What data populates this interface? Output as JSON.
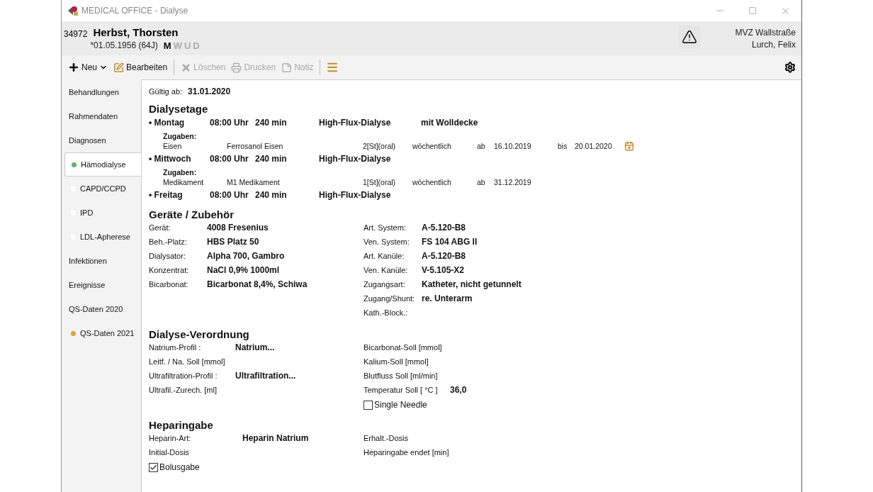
{
  "window": {
    "title": "MEDICAL OFFICE - Dialyse"
  },
  "patient": {
    "id": "34972",
    "name": "Herbst, Thorsten",
    "birth": "*01.05.1956 (64J)",
    "genders": [
      {
        "label": "M",
        "selected": true
      },
      {
        "label": "W",
        "selected": false
      },
      {
        "label": "U",
        "selected": false
      },
      {
        "label": "D",
        "selected": false
      }
    ],
    "warning": true,
    "practice": "MVZ Wallstraße",
    "doctor": "Lurch, Felix"
  },
  "toolbar": [
    {
      "kind": "add",
      "label": "Neu",
      "disabled": false
    },
    {
      "kind": "edit",
      "label": "Bearbeiten",
      "disabled": false
    },
    {
      "kind": "delete",
      "label": "Löschen",
      "disabled": true
    },
    {
      "kind": "print",
      "label": "Drucken",
      "disabled": true
    },
    {
      "kind": "note",
      "label": "Notiz",
      "disabled": true
    }
  ],
  "sidebar": {
    "items": [
      {
        "label": "Behandlungen",
        "selected": false
      },
      {
        "label": "Rahmendaten",
        "selected": false
      },
      {
        "label": "Diagnosen",
        "selected": false
      },
      {
        "label": "Hämodialyse",
        "selected": true,
        "color": "#5fb85f"
      },
      {
        "label": "CAPD/CCPD",
        "selected": false,
        "color": "#ffffff"
      },
      {
        "label": "IPD",
        "selected": false,
        "color": "#ffffff"
      },
      {
        "label": "LDL-Apherese",
        "selected": false,
        "color": "#ffffff"
      },
      {
        "label": "Infektionen",
        "selected": false
      },
      {
        "label": "Ereignisse",
        "selected": false
      },
      {
        "label": "QS-Daten 2020",
        "selected": false
      },
      {
        "label": "QS-Daten 2021",
        "selected": false,
        "color": "#e0a030"
      }
    ]
  },
  "valid_from": {
    "label": "Gültig ab:",
    "value": "31.01.2020"
  },
  "dialysis_days": {
    "title": "Dialysetage",
    "days": [
      {
        "bullet": "•",
        "day": "Montag",
        "time": "08:00 Uhr",
        "duration": "240 min",
        "type": "High-Flux-Dialyse",
        "note": "mit Wolldecke",
        "additions_title": "Zugaben:",
        "additions": [
          {
            "name": "Eisen",
            "product": "Ferrosanol Eisen",
            "dose": "2[St](oral)",
            "frequency": "wöchentlich",
            "from_prefix": "ab",
            "from": "16.10.2019",
            "to_prefix": "bis",
            "to": "20.01.2020",
            "expired": true
          }
        ]
      },
      {
        "bullet": "•",
        "day": "Mittwoch",
        "time": "08:00 Uhr",
        "duration": "240 min",
        "type": "High-Flux-Dialyse",
        "additions_title": "Zugaben:",
        "additions": [
          {
            "name": "Medikament",
            "product": "M1 Medikament",
            "dose": "1[St](oral)",
            "frequency": "wöchentlich",
            "from_prefix": "ab",
            "from": "31.12.2019",
            "expired": false
          }
        ]
      },
      {
        "bullet": "•",
        "day": "Freitag",
        "time": "08:00 Uhr",
        "duration": "240 min",
        "type": "High-Flux-Dialyse"
      }
    ]
  },
  "devices": {
    "title": "Geräte / Zubehör",
    "left": [
      {
        "label": "Gerät:",
        "value": "4008 Fresenius"
      },
      {
        "label": "Beh.-Platz:",
        "value": "HBS Platz 50"
      },
      {
        "label": "Dialysator:",
        "value": "Alpha 700, Gambro"
      },
      {
        "label": "Konzentrat:",
        "value": "NaCl 0,9% 1000ml"
      },
      {
        "label": "Bicarbonat:",
        "value": "Bicarbonat 8,4%, Schiwa"
      }
    ],
    "right": [
      {
        "label": "Art. System:",
        "value": "A-5.120-B8"
      },
      {
        "label": "Ven. System:",
        "value": "FS 104 ABG II"
      },
      {
        "label": "Art. Kanüle:",
        "value": "A-5.120-B8"
      },
      {
        "label": "Ven. Kanüle:",
        "value": "V-5.105-X2"
      },
      {
        "label": "Zugangsart:",
        "value": "Katheter, nicht getunnelt"
      },
      {
        "label": "Zugang/Shunt:",
        "value": "re. Unterarm"
      },
      {
        "label": "Kath.-Block.:"
      }
    ]
  },
  "prescription": {
    "title": "Dialyse-Verordnung",
    "left": [
      {
        "label": "Natrium-Profil :",
        "value": "Natrium..."
      },
      {
        "label": "Leitf. / Na. Soll [mmol]"
      },
      {
        "label": "Ultrafiltration-Profil :",
        "value": "Ultrafiltration..."
      },
      {
        "label": "Ultrafil.-Zurech. [ml]"
      }
    ],
    "right": [
      {
        "label": "Bicarbonat-Soll [mmol]"
      },
      {
        "label": "Kalium-Soll [mmol]"
      },
      {
        "label": "Blutfluss Soll [ml/min]"
      },
      {
        "label": "Temperatur Soll [ °C ]",
        "value": "36,0"
      }
    ],
    "checkbox": {
      "label": "Single Needle",
      "checked": false
    }
  },
  "heparin": {
    "title": "Heparingabe",
    "left": [
      {
        "label": "Heparin-Art:",
        "value": "Heparin Natrium"
      },
      {
        "label": "Initial-Dosis"
      }
    ],
    "right": [
      {
        "label": "Erhalt.-Dosis"
      },
      {
        "label": "Heparingabe endet [min]"
      }
    ],
    "checkbox": {
      "label": "Bolusgabe",
      "checked": true
    }
  }
}
